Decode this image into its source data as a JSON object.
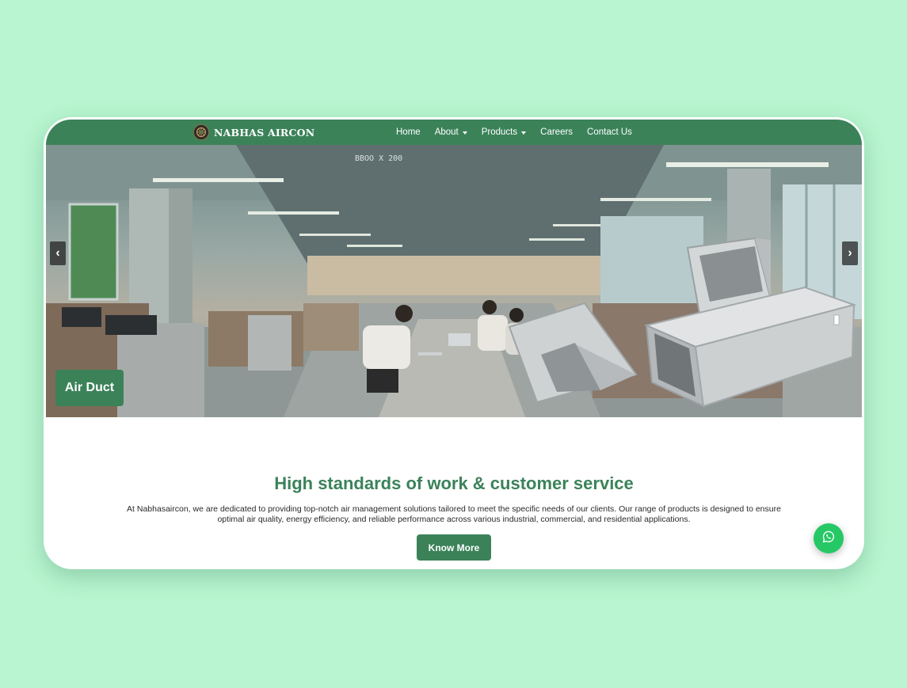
{
  "brand": {
    "name": "NABHAS AIRCON"
  },
  "nav": {
    "items": [
      {
        "label": "Home",
        "has_dropdown": false
      },
      {
        "label": "About",
        "has_dropdown": true
      },
      {
        "label": "Products",
        "has_dropdown": true
      },
      {
        "label": "Careers",
        "has_dropdown": false
      },
      {
        "label": "Contact Us",
        "has_dropdown": false
      }
    ]
  },
  "hero": {
    "prev_arrow": "‹",
    "next_arrow": "›",
    "caption": "Air Duct",
    "ceiling_label": "BBOO X 200"
  },
  "intro": {
    "heading": "High standards of work & customer service",
    "description": "At Nabhasaircon, we are dedicated to providing top-notch air management solutions tailored to meet the specific needs of our clients. Our range of products is designed to ensure optimal air quality, energy efficiency, and reliable performance across various industrial, commercial, and residential applications.",
    "button_label": "Know More"
  },
  "colors": {
    "brand_green": "#3b8259",
    "background_mint": "#b8f5d0",
    "whatsapp_green": "#25c865"
  },
  "icons": {
    "logo": "brand-logo-icon",
    "whatsapp": "whatsapp-icon"
  }
}
